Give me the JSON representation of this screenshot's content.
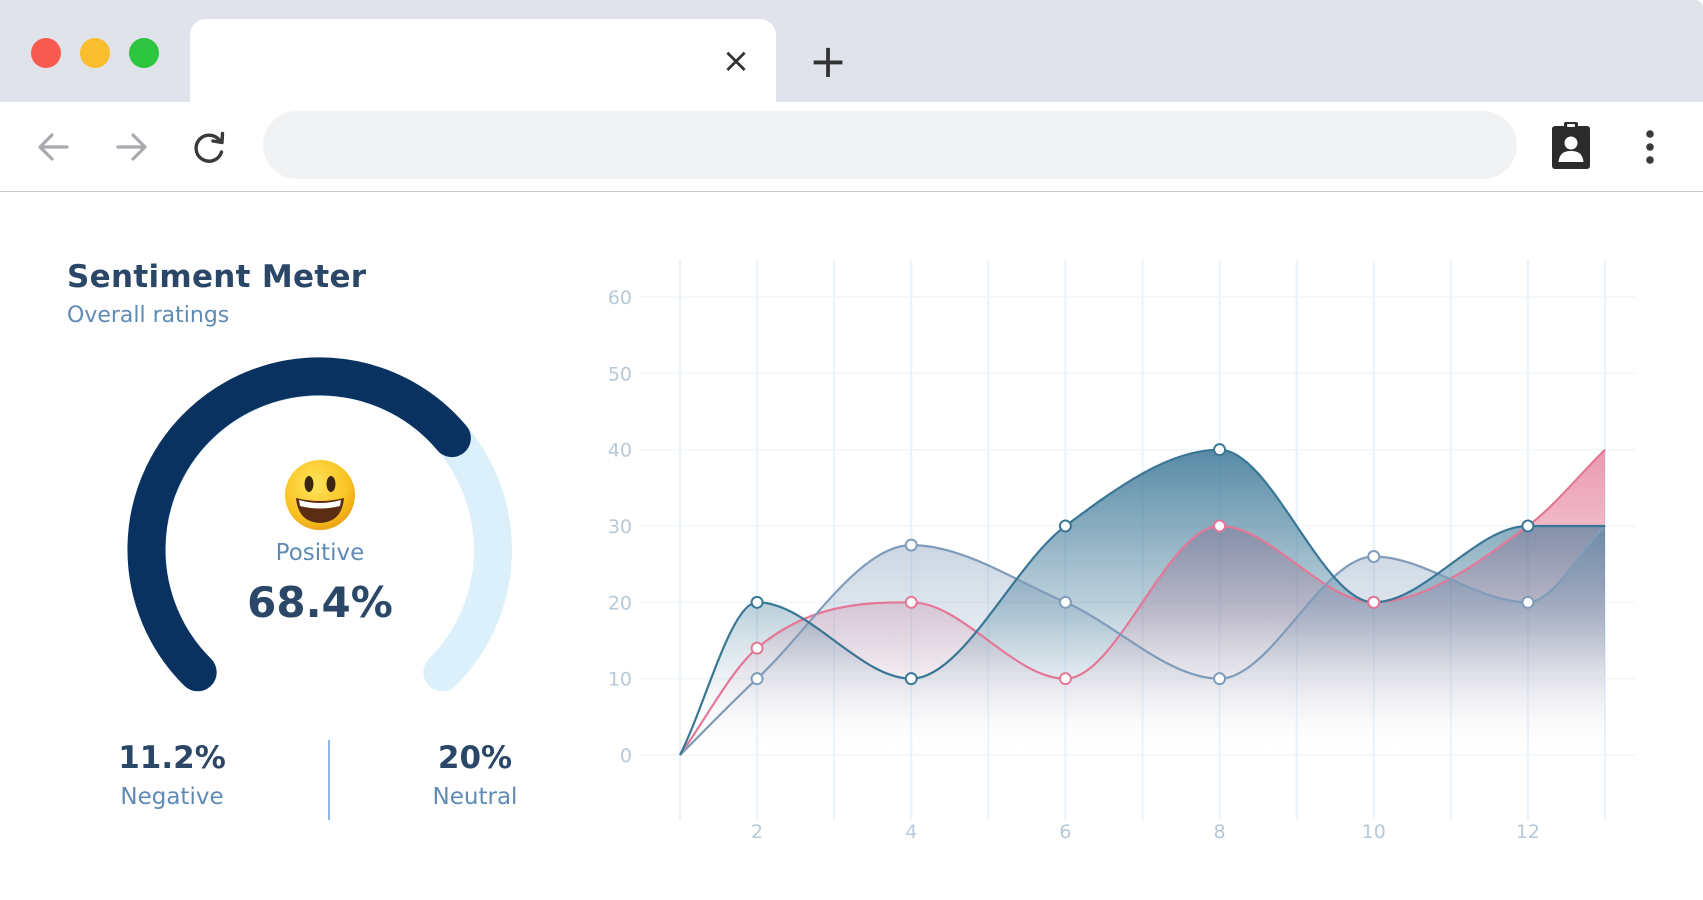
{
  "browser": {
    "tab_title": "",
    "tab_close_label": "×",
    "new_tab_label": "+",
    "address": "",
    "traffic_lights": [
      "#f85a50",
      "#f9be2d",
      "#2ec640"
    ]
  },
  "panel": {
    "title": "Sentiment Meter",
    "subtitle": "Overall ratings",
    "gauge": {
      "emoji": "smiling-face-icon",
      "label": "Positive",
      "value_text": "68.4%",
      "value": 68.4,
      "color": "#0a3261",
      "track_color": "#dcf0fb"
    },
    "stats": [
      {
        "value": "11.2%",
        "label": "Negative"
      },
      {
        "value": "20%",
        "label": "Neutral"
      }
    ]
  },
  "chart_data": {
    "type": "area",
    "x": [
      1,
      2,
      3,
      4,
      5,
      6,
      7,
      8,
      9,
      10,
      11,
      12,
      13
    ],
    "x_ticks": [
      "2",
      "4",
      "6",
      "8",
      "10",
      "12"
    ],
    "x_tick_values": [
      2,
      4,
      6,
      8,
      10,
      12
    ],
    "y_ticks": [
      "0",
      "10",
      "20",
      "30",
      "40",
      "50",
      "60"
    ],
    "ylim": [
      0,
      60
    ],
    "xlim": [
      1,
      13
    ],
    "grid": true,
    "legend": null,
    "series": [
      {
        "color": "#3a7696",
        "points": [
          [
            1,
            0
          ],
          [
            2,
            20
          ],
          [
            4,
            10
          ],
          [
            6,
            30
          ],
          [
            8,
            40
          ],
          [
            10,
            20
          ],
          [
            12,
            30
          ],
          [
            13,
            30
          ]
        ],
        "markers": [
          2,
          4,
          6,
          8,
          10,
          12
        ]
      },
      {
        "color": "#7f9cba",
        "points": [
          [
            1,
            0
          ],
          [
            2,
            10
          ],
          [
            4,
            27.5
          ],
          [
            6,
            20
          ],
          [
            8,
            10
          ],
          [
            10,
            26
          ],
          [
            12,
            20
          ],
          [
            13,
            30
          ]
        ],
        "markers": [
          2,
          4,
          6,
          8,
          10,
          12
        ]
      },
      {
        "color": "#e47897",
        "points": [
          [
            1,
            0
          ],
          [
            2,
            14
          ],
          [
            4,
            20
          ],
          [
            6,
            10
          ],
          [
            8,
            30
          ],
          [
            10,
            20
          ],
          [
            12,
            30
          ],
          [
            13,
            40
          ]
        ],
        "markers": [
          2,
          4,
          6,
          8,
          10
        ]
      }
    ]
  }
}
